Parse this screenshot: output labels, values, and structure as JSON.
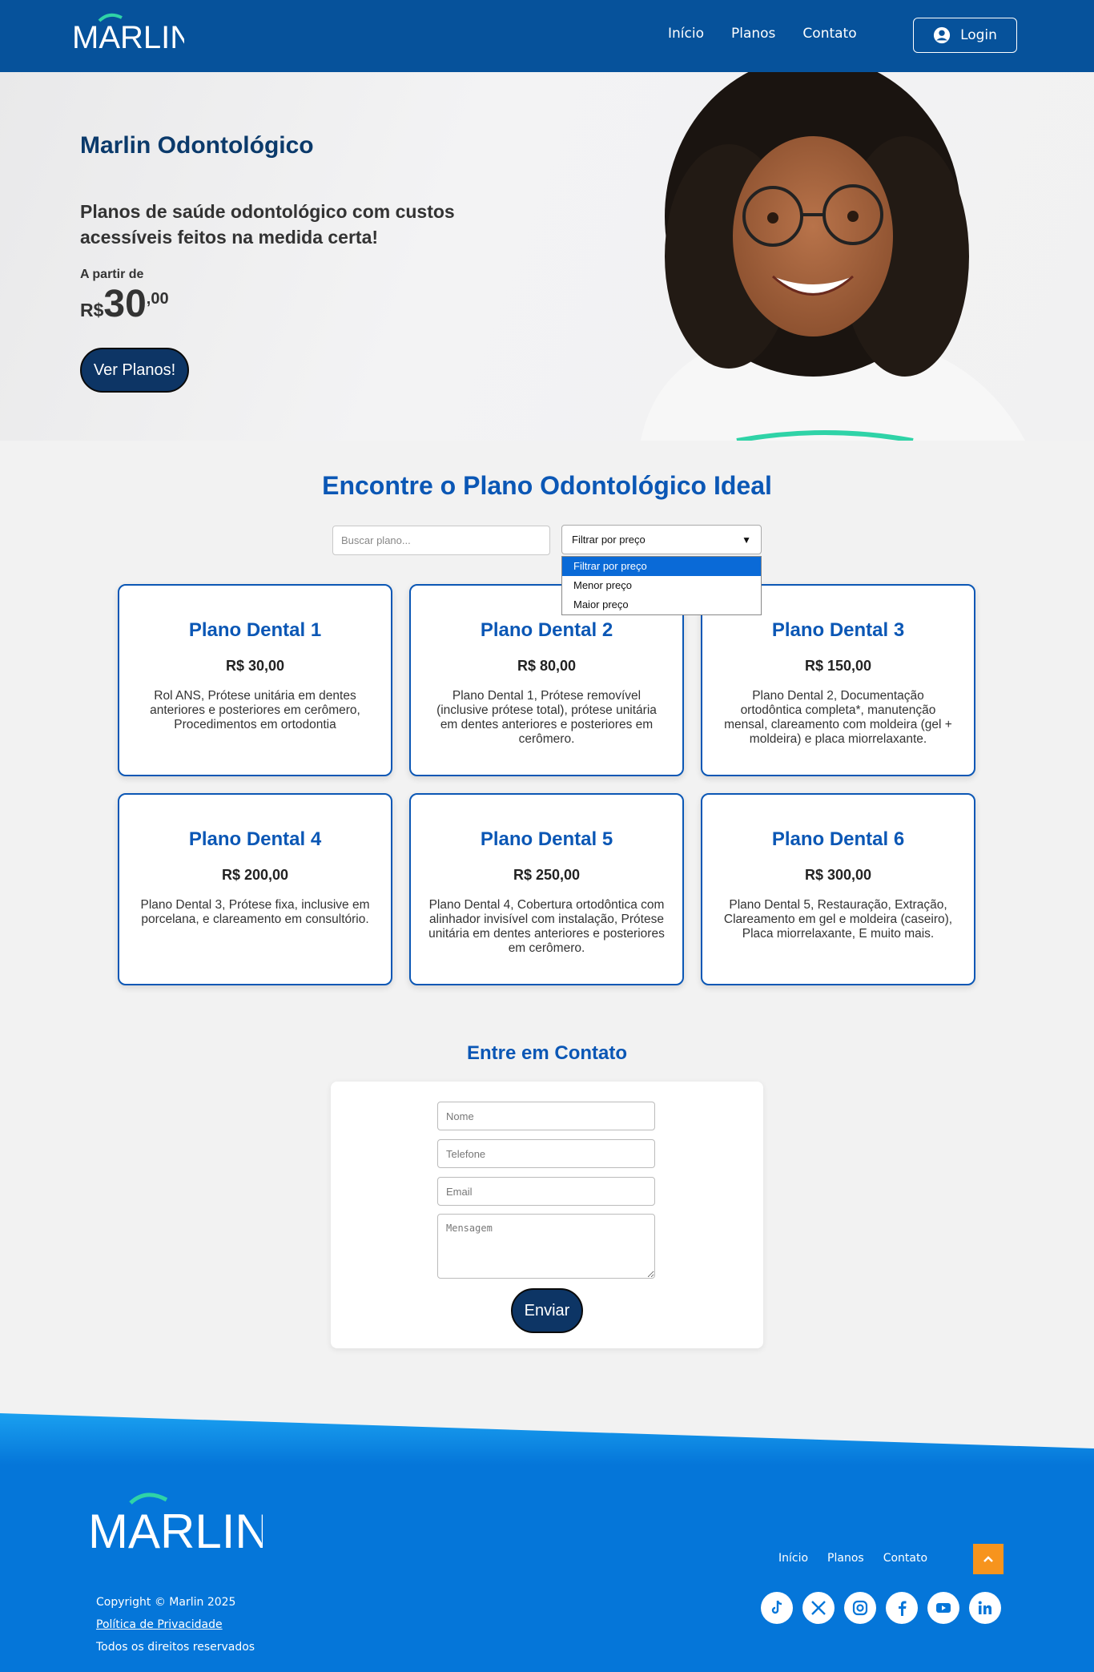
{
  "header": {
    "logo_text": "MARLIN",
    "nav": [
      "Início",
      "Planos",
      "Contato"
    ],
    "login_label": "Login"
  },
  "hero": {
    "title": "Marlin Odontológico",
    "subtitle": "Planos de saúde odontológico com custos acessíveis feitos na medida certa!",
    "from_label": "A partir de",
    "currency": "R$",
    "price_int": "30",
    "price_cents": ",00",
    "cta_label": "Ver Planos!"
  },
  "plans": {
    "title": "Encontre o Plano Odontológico Ideal",
    "search_placeholder": "Buscar plano...",
    "filter_selected": "Filtrar por preço",
    "filter_options": [
      "Filtrar por preço",
      "Menor preço",
      "Maior preço"
    ],
    "cards": [
      {
        "name": "Plano Dental 1",
        "price": "R$ 30,00",
        "desc": "Rol ANS, Prótese unitária em dentes anteriores e posteriores em cerômero, Procedimentos em ortodontia"
      },
      {
        "name": "Plano Dental 2",
        "price": "R$ 80,00",
        "desc": "Plano Dental 1, Prótese removível (inclusive prótese total), prótese unitária em dentes anteriores e posteriores em cerômero."
      },
      {
        "name": "Plano Dental 3",
        "price": "R$ 150,00",
        "desc": "Plano Dental 2, Documentação ortodôntica completa*, manutenção mensal, clareamento com moldeira (gel + moldeira) e placa miorrelaxante."
      },
      {
        "name": "Plano Dental 4",
        "price": "R$ 200,00",
        "desc": "Plano Dental 3, Prótese fixa, inclusive em porcelana, e clareamento em consultório."
      },
      {
        "name": "Plano Dental 5",
        "price": "R$ 250,00",
        "desc": "Plano Dental 4, Cobertura ortodôntica com alinhador invisível com instalação, Prótese unitária em dentes anteriores e posteriores em cerômero."
      },
      {
        "name": "Plano Dental 6",
        "price": "R$ 300,00",
        "desc": "Plano Dental 5, Restauração, Extração, Clareamento em gel e moldeira (caseiro), Placa miorrelaxante, E muito mais."
      }
    ]
  },
  "contact": {
    "title": "Entre em Contato",
    "name_placeholder": "Nome",
    "phone_placeholder": "Telefone",
    "email_placeholder": "Email",
    "message_placeholder": "Mensagem",
    "submit_label": "Enviar"
  },
  "footer": {
    "logo_text": "MARLIN",
    "nav": [
      "Início",
      "Planos",
      "Contato"
    ],
    "copyright": "Copyright © Marlin 2025",
    "privacy": "Política de Privacidade",
    "rights": "Todos os direitos reservados",
    "socials": [
      "tiktok-icon",
      "x-icon",
      "instagram-icon",
      "facebook-icon",
      "youtube-icon",
      "linkedin-icon"
    ]
  },
  "colors": {
    "header_bg": "#06529b",
    "accent_blue": "#0b57b5",
    "button_dark": "#0d3565",
    "footer_blue": "#0576d9",
    "top_button": "#f7941d",
    "logo_swoosh": "#2fd3a7"
  }
}
